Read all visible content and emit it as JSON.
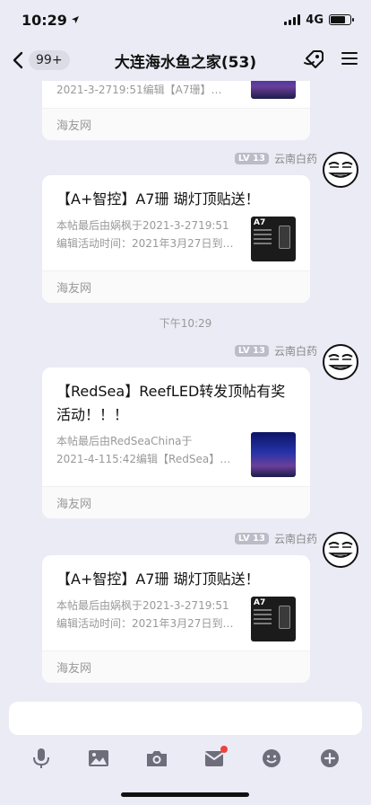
{
  "status": {
    "time": "10:29",
    "network": "4G",
    "battery_level": 0.75
  },
  "nav": {
    "back_count": "99+",
    "title": "大连海水鱼之家(53)"
  },
  "messages": [
    {
      "title": "",
      "desc_line1": "",
      "desc_line2": "2021-3-2719:51编辑【A7珊】…",
      "source": "海友网"
    },
    {
      "sender_level": "LV 13",
      "sender_name": "云南白药",
      "title": "【A+智控】A7珊 瑚灯顶贴送！",
      "desc_line1": "本帖最后由娲枫于2021-3-2719:51",
      "desc_line2": "编辑活动时间：2021年3月27日到…",
      "thumb_label": "A7",
      "source": "海友网"
    },
    {
      "sender_level": "LV 13",
      "sender_name": "云南白药",
      "title_line1": "【RedSea】ReefLED转发顶帖有奖",
      "title_line2": "活动！！！",
      "desc_line1": "本帖最后由RedSeaChina于",
      "desc_line2": "2021-4-115:42编辑【RedSea】…",
      "source": "海友网"
    },
    {
      "sender_level": "LV 13",
      "sender_name": "云南白药",
      "title": "【A+智控】A7珊 瑚灯顶贴送！",
      "desc_line1": "本帖最后由娲枫于2021-3-2719:51",
      "desc_line2": "编辑活动时间：2021年3月27日到…",
      "thumb_label": "A7",
      "source": "海友网"
    }
  ],
  "timestamp": "下午10:29",
  "toolbar": {
    "icons": [
      "microphone-icon",
      "image-icon",
      "camera-icon",
      "red-packet-icon",
      "emoji-icon",
      "plus-icon"
    ],
    "notify_color": "#f04040"
  }
}
